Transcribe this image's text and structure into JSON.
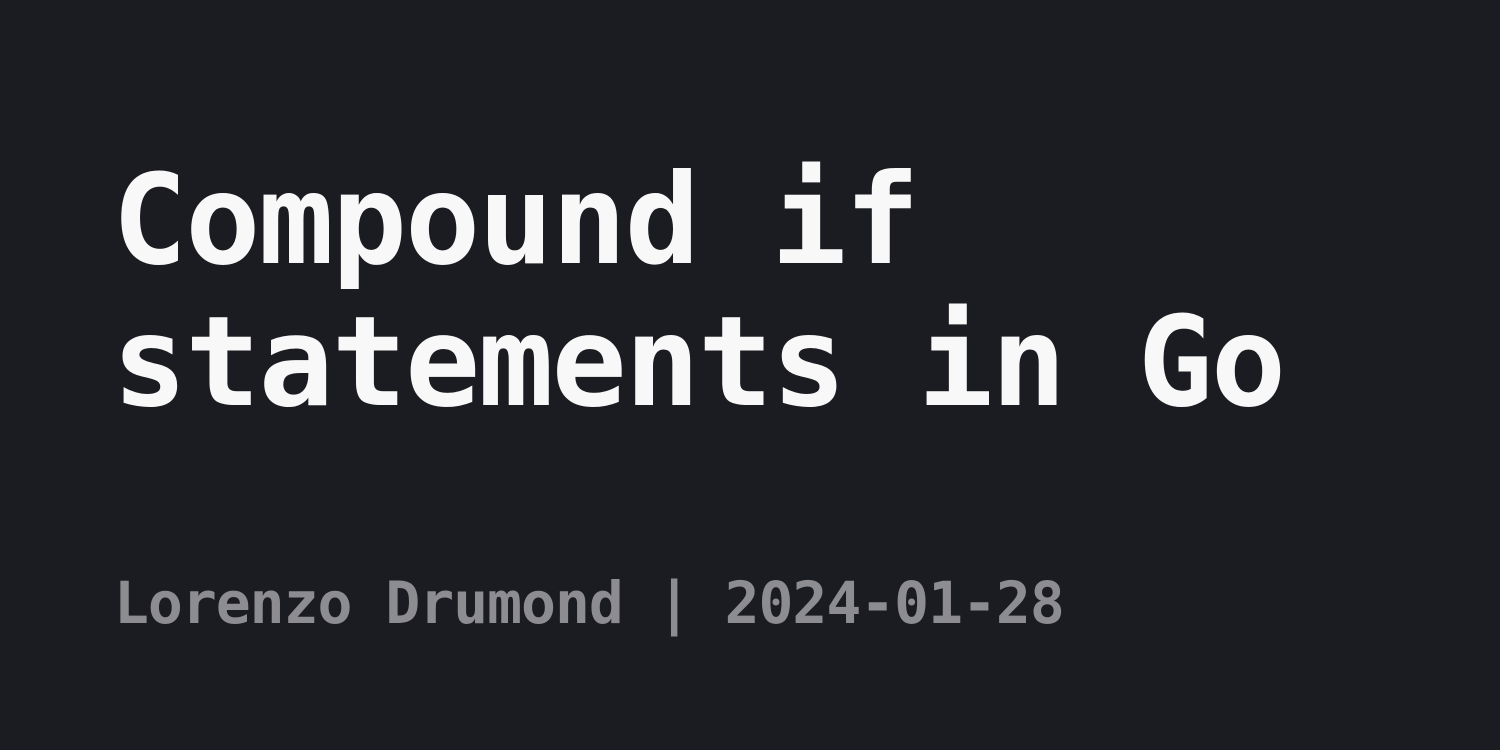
{
  "title": {
    "line1": "Compound if",
    "line2": "statements in Go"
  },
  "meta": {
    "author": "Lorenzo Drumond",
    "separator": "|",
    "date": "2024-01-28"
  },
  "colors": {
    "background": "#1b1c21",
    "title": "#f8f8f8",
    "meta": "#8c8c91"
  }
}
